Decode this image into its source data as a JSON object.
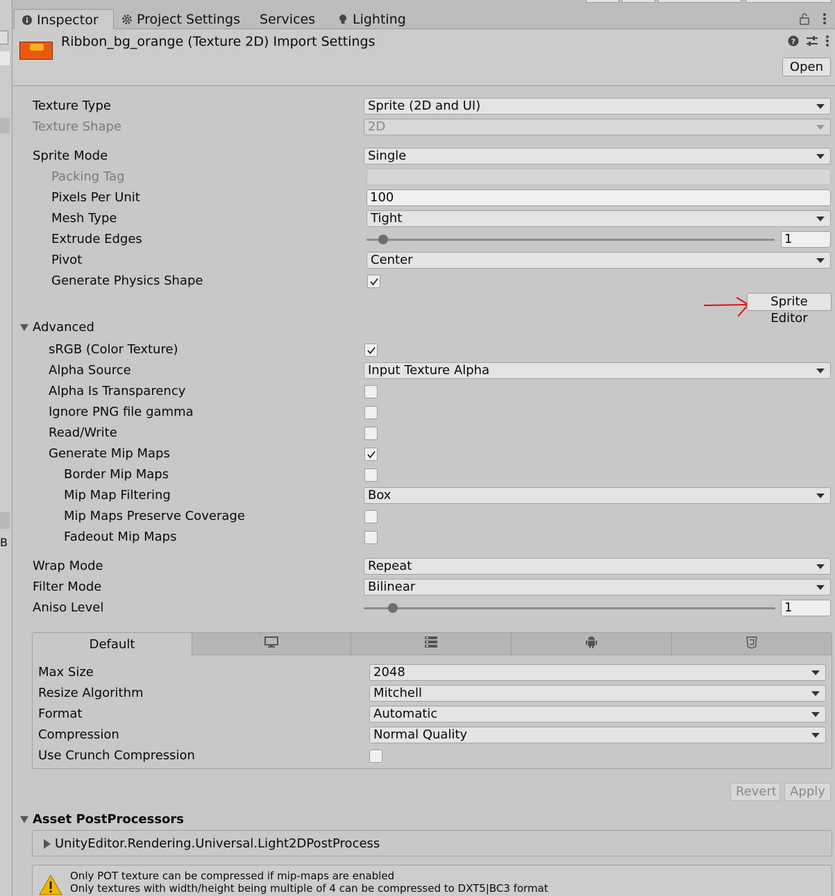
{
  "tabs": [
    {
      "label": "Inspector",
      "icon": "info-icon"
    },
    {
      "label": "Project Settings",
      "icon": "gear-icon"
    },
    {
      "label": "Services",
      "icon": ""
    },
    {
      "label": "Lighting",
      "icon": "bulb-icon"
    }
  ],
  "left_strip": {
    "letter": "B"
  },
  "header": {
    "title": "Ribbon_bg_orange (Texture 2D) Import Settings",
    "open_label": "Open"
  },
  "fields": {
    "texture_type": {
      "label": "Texture Type",
      "value": "Sprite (2D and UI)"
    },
    "texture_shape": {
      "label": "Texture Shape",
      "value": "2D"
    },
    "sprite_mode": {
      "label": "Sprite Mode",
      "value": "Single"
    },
    "packing_tag": {
      "label": "Packing Tag",
      "value": ""
    },
    "pixels_per_unit": {
      "label": "Pixels Per Unit",
      "value": "100"
    },
    "mesh_type": {
      "label": "Mesh Type",
      "value": "Tight"
    },
    "extrude_edges": {
      "label": "Extrude Edges",
      "value": "1",
      "slider_fraction": 0.04
    },
    "pivot": {
      "label": "Pivot",
      "value": "Center"
    },
    "generate_physics_shape": {
      "label": "Generate Physics Shape",
      "checked": true
    },
    "sprite_editor_label": "Sprite Editor"
  },
  "advanced": {
    "label": "Advanced",
    "srgb": {
      "label": "sRGB (Color Texture)",
      "checked": true
    },
    "alpha_source": {
      "label": "Alpha Source",
      "value": "Input Texture Alpha"
    },
    "alpha_is_transparency": {
      "label": "Alpha Is Transparency",
      "checked": false
    },
    "ignore_png_gamma": {
      "label": "Ignore PNG file gamma",
      "checked": false
    },
    "read_write": {
      "label": "Read/Write",
      "checked": false
    },
    "generate_mip_maps": {
      "label": "Generate Mip Maps",
      "checked": true
    },
    "border_mip_maps": {
      "label": "Border Mip Maps",
      "checked": false
    },
    "mip_map_filtering": {
      "label": "Mip Map Filtering",
      "value": "Box"
    },
    "mip_maps_preserve_coverage": {
      "label": "Mip Maps Preserve Coverage",
      "checked": false
    },
    "fadeout_mip_maps": {
      "label": "Fadeout Mip Maps",
      "checked": false
    }
  },
  "wrap": {
    "wrap_mode": {
      "label": "Wrap Mode",
      "value": "Repeat"
    },
    "filter_mode": {
      "label": "Filter Mode",
      "value": "Bilinear"
    },
    "aniso_level": {
      "label": "Aniso Level",
      "value": "1",
      "slider_fraction": 0.07
    }
  },
  "platform": {
    "tabs": [
      {
        "label": "Default",
        "icon": ""
      },
      {
        "label": "",
        "icon": "monitor-icon"
      },
      {
        "label": "",
        "icon": "server-icon"
      },
      {
        "label": "",
        "icon": "android-icon"
      },
      {
        "label": "",
        "icon": "html5-icon"
      }
    ],
    "max_size": {
      "label": "Max Size",
      "value": "2048"
    },
    "resize_algorithm": {
      "label": "Resize Algorithm",
      "value": "Mitchell"
    },
    "format": {
      "label": "Format",
      "value": "Automatic"
    },
    "compression": {
      "label": "Compression",
      "value": "Normal Quality"
    },
    "use_crunch": {
      "label": "Use Crunch Compression",
      "checked": false
    }
  },
  "actions": {
    "revert": "Revert",
    "apply": "Apply"
  },
  "postprocessors": {
    "label": "Asset PostProcessors",
    "item": "UnityEditor.Rendering.Universal.Light2DPostProcess"
  },
  "warning": {
    "line1": "Only POT texture can be compressed if mip-maps are enabled",
    "line2": "Only textures with width/height being multiple of 4 can be compressed to DXT5|BC3 format"
  },
  "colors": {
    "annotation_arrow": "#e01010",
    "thumbnail": "#e85a12"
  }
}
